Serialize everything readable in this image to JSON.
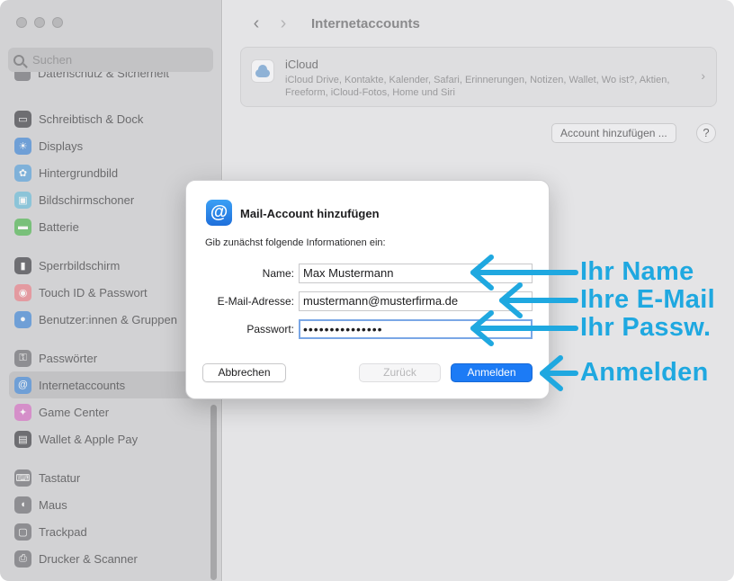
{
  "sidebar": {
    "search_placeholder": "Suchen",
    "cut_item": "Datenschutz & Sicherheit",
    "items": [
      {
        "label": "Schreibtisch & Dock",
        "icon": "dock-icon",
        "color": "#6e6e72"
      },
      {
        "label": "Displays",
        "icon": "display-icon",
        "color": "#6f9fd6"
      },
      {
        "label": "Hintergrundbild",
        "icon": "wallpaper-icon",
        "color": "#7fb1d9"
      },
      {
        "label": "Bildschirmschoner",
        "icon": "screensaver-icon",
        "color": "#8cc4d8"
      },
      {
        "label": "Batterie",
        "icon": "battery-icon",
        "color": "#79c07a"
      },
      {
        "label": "Sperrbildschirm",
        "icon": "lock-icon",
        "color": "#6e6e72"
      },
      {
        "label": "Touch ID & Passwort",
        "icon": "fingerprint-icon",
        "color": "#e39aa0"
      },
      {
        "label": "Benutzer:innen & Gruppen",
        "icon": "users-icon",
        "color": "#6f9fd6"
      },
      {
        "label": "Passwörter",
        "icon": "key-icon",
        "color": "#8e8e92"
      },
      {
        "label": "Internetaccounts",
        "icon": "at-icon",
        "color": "#6f9fd6"
      },
      {
        "label": "Game Center",
        "icon": "game-center-icon",
        "color": "#d58fc9"
      },
      {
        "label": "Wallet & Apple Pay",
        "icon": "wallet-icon",
        "color": "#6e6e72"
      },
      {
        "label": "Tastatur",
        "icon": "keyboard-icon",
        "color": "#8e8e92"
      },
      {
        "label": "Maus",
        "icon": "mouse-icon",
        "color": "#8e8e92"
      },
      {
        "label": "Trackpad",
        "icon": "trackpad-icon",
        "color": "#8e8e92"
      },
      {
        "label": "Drucker & Scanner",
        "icon": "printer-icon",
        "color": "#8e8e92"
      }
    ],
    "active": "Internetaccounts"
  },
  "header": {
    "title": "Internetaccounts"
  },
  "icloud": {
    "name": "iCloud",
    "description": "iCloud Drive, Kontakte, Kalender, Safari, Erinnerungen, Notizen, Wallet, Wo ist?, Aktien, Freeform, iCloud-Fotos, Home und Siri"
  },
  "actions": {
    "add_account": "Account hinzufügen ...",
    "help": "?"
  },
  "dialog": {
    "title": "Mail-Account hinzufügen",
    "subtitle": "Gib zunächst folgende Informationen ein:",
    "fields": {
      "name_label": "Name:",
      "name_value": "Max Mustermann",
      "email_label": "E-Mail-Adresse:",
      "email_value": "mustermann@musterfirma.de",
      "password_label": "Passwort:",
      "password_value": "•••••••••••••••"
    },
    "buttons": {
      "cancel": "Abbrechen",
      "back": "Zurück",
      "login": "Anmelden"
    }
  },
  "annotations": {
    "name": "Ihr Name",
    "email": "Ihre E-Mail",
    "password": "Ihr Passw.",
    "login": "Anmelden",
    "color": "#1fa8e0"
  }
}
